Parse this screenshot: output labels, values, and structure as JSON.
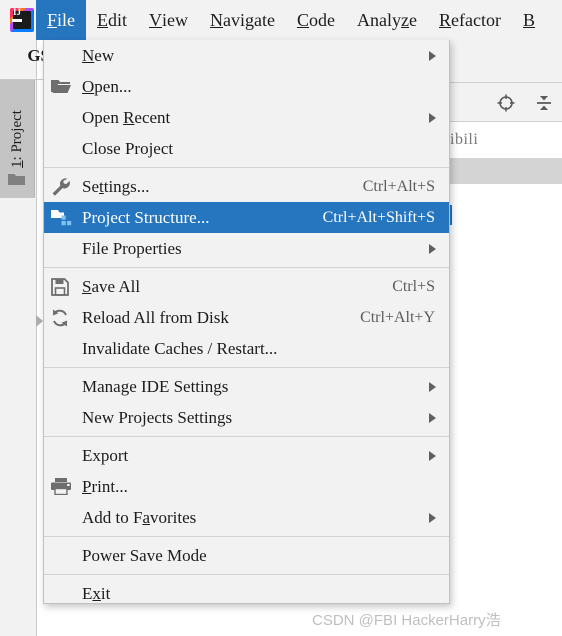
{
  "window": {
    "app": "IntelliJ IDEA",
    "logo_text": "IJ"
  },
  "menubar": {
    "items": [
      {
        "label": "File",
        "mnemonic": "F",
        "active": true
      },
      {
        "label": "Edit",
        "mnemonic": "E",
        "active": false
      },
      {
        "label": "View",
        "mnemonic": "V",
        "active": false
      },
      {
        "label": "Navigate",
        "mnemonic": "N",
        "active": false
      },
      {
        "label": "Code",
        "mnemonic": "C",
        "active": false
      },
      {
        "label": "Analyze",
        "mnemonic": "z",
        "active": false
      },
      {
        "label": "Refactor",
        "mnemonic": "R",
        "active": false
      },
      {
        "label": "B",
        "mnemonic": "B",
        "active": false
      }
    ]
  },
  "background": {
    "gs_label": "GS",
    "project_tool_window": {
      "label": "1: Project",
      "mnemonic": "1"
    },
    "project_tree_text": "ibili",
    "toolbar_icons": [
      {
        "name": "locate-icon",
        "title": "Select Opened File"
      },
      {
        "name": "collapse-all-icon",
        "title": "Collapse All"
      }
    ]
  },
  "file_menu": {
    "title": "File",
    "items": [
      {
        "type": "item",
        "label": "New",
        "mnemonic": "N",
        "icon": "none",
        "shortcut": "",
        "submenu": true,
        "selected": false
      },
      {
        "type": "item",
        "label": "Open...",
        "mnemonic": "O",
        "icon": "open-folder-icon",
        "shortcut": "",
        "submenu": false,
        "selected": false
      },
      {
        "type": "item",
        "label": "Open Recent",
        "mnemonic": "R",
        "icon": "none",
        "shortcut": "",
        "submenu": true,
        "selected": false
      },
      {
        "type": "item",
        "label": "Close Project",
        "mnemonic": "",
        "icon": "none",
        "shortcut": "",
        "submenu": false,
        "selected": false
      },
      {
        "type": "separator"
      },
      {
        "type": "item",
        "label": "Settings...",
        "mnemonic": "t",
        "icon": "wrench-icon",
        "shortcut": "Ctrl+Alt+S",
        "submenu": false,
        "selected": false
      },
      {
        "type": "item",
        "label": "Project Structure...",
        "mnemonic": "",
        "icon": "module-icon",
        "shortcut": "Ctrl+Alt+Shift+S",
        "submenu": false,
        "selected": true
      },
      {
        "type": "item",
        "label": "File Properties",
        "mnemonic": "",
        "icon": "none",
        "shortcut": "",
        "submenu": true,
        "selected": false
      },
      {
        "type": "separator"
      },
      {
        "type": "item",
        "label": "Save All",
        "mnemonic": "S",
        "icon": "save-icon",
        "shortcut": "Ctrl+S",
        "submenu": false,
        "selected": false
      },
      {
        "type": "item",
        "label": "Reload All from Disk",
        "mnemonic": "",
        "icon": "reload-icon",
        "shortcut": "Ctrl+Alt+Y",
        "submenu": false,
        "selected": false
      },
      {
        "type": "item",
        "label": "Invalidate Caches / Restart...",
        "mnemonic": "",
        "icon": "none",
        "shortcut": "",
        "submenu": false,
        "selected": false
      },
      {
        "type": "separator"
      },
      {
        "type": "item",
        "label": "Manage IDE Settings",
        "mnemonic": "",
        "icon": "none",
        "shortcut": "",
        "submenu": true,
        "selected": false
      },
      {
        "type": "item",
        "label": "New Projects Settings",
        "mnemonic": "",
        "icon": "none",
        "shortcut": "",
        "submenu": true,
        "selected": false
      },
      {
        "type": "separator"
      },
      {
        "type": "item",
        "label": "Export",
        "mnemonic": "",
        "icon": "none",
        "shortcut": "",
        "submenu": true,
        "selected": false
      },
      {
        "type": "item",
        "label": "Print...",
        "mnemonic": "P",
        "icon": "printer-icon",
        "shortcut": "",
        "submenu": false,
        "selected": false
      },
      {
        "type": "item",
        "label": "Add to Favorites",
        "mnemonic": "a",
        "icon": "none",
        "shortcut": "",
        "submenu": true,
        "selected": false
      },
      {
        "type": "separator"
      },
      {
        "type": "item",
        "label": "Power Save Mode",
        "mnemonic": "",
        "icon": "none",
        "shortcut": "",
        "submenu": false,
        "selected": false
      },
      {
        "type": "separator"
      },
      {
        "type": "item",
        "label": "Exit",
        "mnemonic": "x",
        "icon": "none",
        "shortcut": "",
        "submenu": false,
        "selected": false
      }
    ]
  },
  "watermark": {
    "text": "CSDN @FBI HackerHarry浩"
  },
  "colors": {
    "accent": "#2675bf",
    "menu_bg": "#f2f2f2",
    "text": "#1c1c1c",
    "shortcut_text": "#5c5c5c",
    "separator": "#d2d2d2",
    "watermark": "#bfbfbf"
  }
}
